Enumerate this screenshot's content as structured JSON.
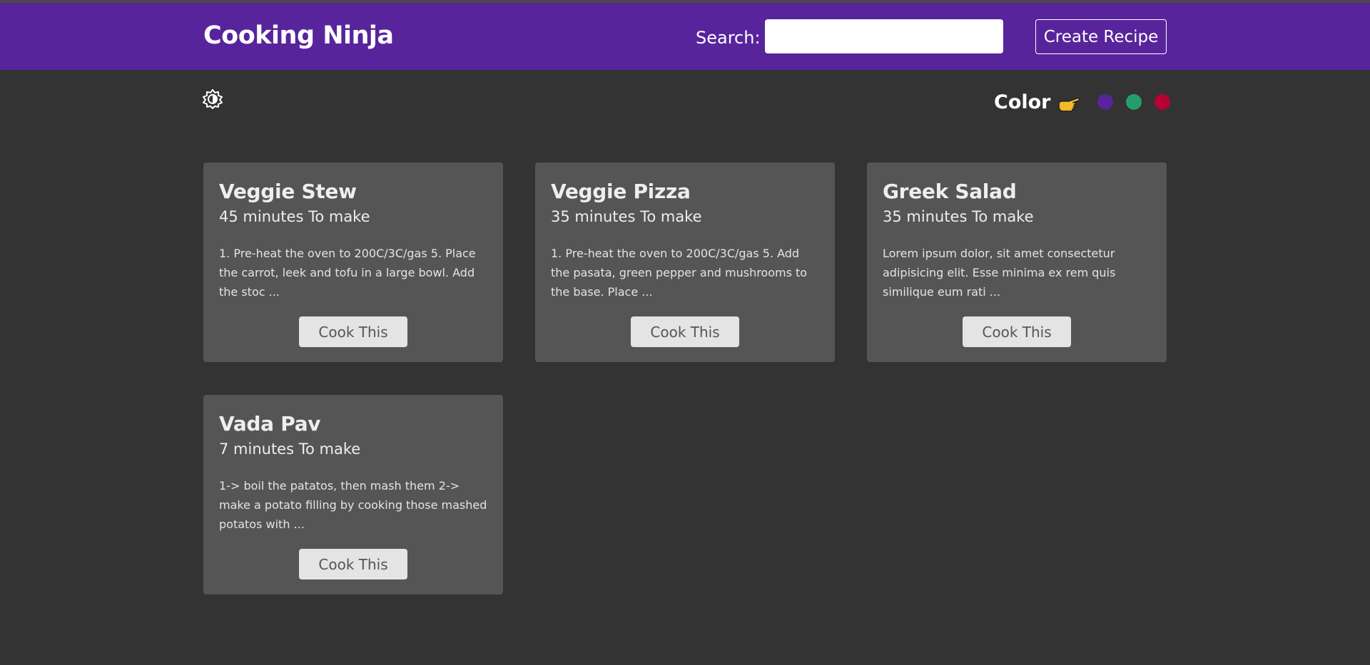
{
  "navbar": {
    "brand": "Cooking Ninja",
    "search_label": "Search:",
    "search_value": "",
    "create_label": "Create Recipe",
    "background_color": "#58249c"
  },
  "theme": {
    "mode_icon": "brightness-icon",
    "color_label": "Color",
    "pointer_icon": "pointing-hand-icon",
    "swatches": [
      {
        "color": "#58249c",
        "icon": "purple-swatch"
      },
      {
        "color": "#249c6b",
        "icon": "green-swatch"
      },
      {
        "color": "#b70233",
        "icon": "red-swatch"
      }
    ]
  },
  "recipes": [
    {
      "title": "Veggie Stew",
      "time": "45 minutes To make",
      "method": "1. Pre-heat the oven to 200C/3C/gas 5. Place the carrot, leek and tofu in a large bowl. Add the stoc ...",
      "button": "Cook This"
    },
    {
      "title": "Veggie Pizza",
      "time": "35 minutes To make",
      "method": "1. Pre-heat the oven to 200C/3C/gas 5. Add the pasata, green pepper and mushrooms to the base. Place ...",
      "button": "Cook This"
    },
    {
      "title": "Greek Salad",
      "time": "35 minutes To make",
      "method": "Lorem ipsum dolor, sit amet consectetur adipisicing elit. Esse minima ex rem quis similique eum rati ...",
      "button": "Cook This"
    },
    {
      "title": "Vada Pav",
      "time": "7 minutes To make",
      "method": "1-> boil the patatos, then mash them 2-> make a potato filling by cooking those mashed potatos with ...",
      "button": "Cook This"
    }
  ]
}
